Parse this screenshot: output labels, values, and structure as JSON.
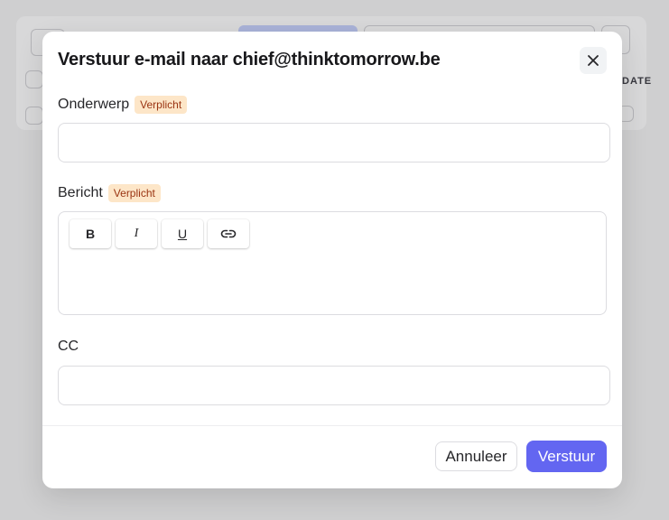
{
  "background": {
    "side_label": "DATE"
  },
  "modal": {
    "title": "Verstuur e-mail naar chief@thinktomorrow.be",
    "subject": {
      "label": "Onderwerp",
      "badge": "Verplicht",
      "value": ""
    },
    "message": {
      "label": "Bericht",
      "badge": "Verplicht",
      "toolbar": {
        "bold": "B",
        "italic": "I",
        "underline": "U"
      },
      "value": ""
    },
    "cc": {
      "label": "CC",
      "value": ""
    },
    "footer": {
      "cancel_label": "Annuleer",
      "send_label": "Verstuur"
    },
    "icons": [
      "close-icon",
      "link-icon"
    ]
  },
  "colors": {
    "accent": "#6366f1",
    "badge_bg": "#fde6c8",
    "badge_text": "#9a3412"
  }
}
